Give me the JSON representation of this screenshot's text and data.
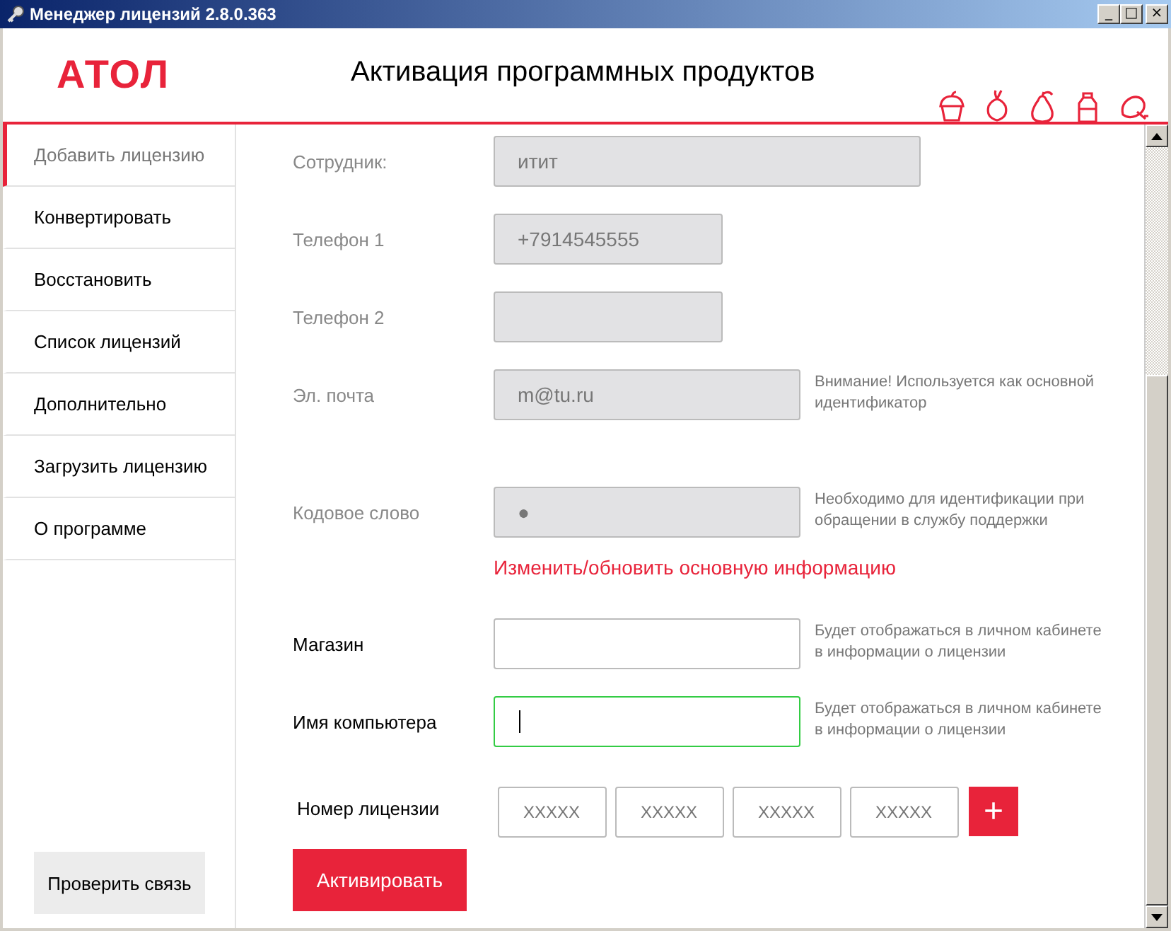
{
  "window": {
    "title": "Менеджер лицензий 2.8.0.363",
    "controls": [
      "_",
      "□",
      "×"
    ]
  },
  "header": {
    "logo": "АТОЛ",
    "title": "Активация программных продуктов"
  },
  "sidebar": {
    "items": [
      {
        "label": "Добавить лицензию",
        "selected": true
      },
      {
        "label": "Конвертировать",
        "selected": false
      },
      {
        "label": "Восстановить",
        "selected": false
      },
      {
        "label": "Список лицензий",
        "selected": false
      },
      {
        "label": "Дополнительно",
        "selected": false
      },
      {
        "label": "Загрузить лицензию",
        "selected": false
      },
      {
        "label": "О программе",
        "selected": false
      }
    ],
    "check_button": "Проверить связь"
  },
  "form": {
    "fields": [
      {
        "label": "Сотрудник:",
        "value": "итит",
        "disabled": true,
        "focused": false
      },
      {
        "label": "Телефон 1",
        "value": "+7914545555",
        "disabled": true,
        "focused": false
      },
      {
        "label": "Телефон 2",
        "disabled": true,
        "focused": false
      },
      {
        "label": "Эл. почта",
        "value": "m@tu.ru",
        "disabled": true,
        "focused": false,
        "hint": "Внимание! Используется как основной идентификатор"
      },
      {
        "label": "Кодовое слово",
        "value": "●",
        "disabled": true,
        "focused": false,
        "hint": "Необходимо для идентификации при обращении в службу поддержки"
      },
      {
        "link": "Изменить/обновить основную информацию"
      },
      {
        "label": "Магазин",
        "disabled": false,
        "focused": false,
        "hint": "Будет отображаться в личном кабинете в информации о лицензии"
      },
      {
        "label": "Имя компьютера",
        "disabled": false,
        "focused": true,
        "hint": "Будет отображаться в личном кабинете в информации о лицензии"
      }
    ],
    "license": {
      "label": "Номер лицензии",
      "parts": [
        {
          "placeholder": "XXXXX"
        },
        {
          "placeholder": "XXXXX"
        },
        {
          "placeholder": "XXXXX"
        },
        {
          "placeholder": "XXXXX"
        }
      ],
      "add": "+"
    },
    "submit": "Активировать"
  }
}
